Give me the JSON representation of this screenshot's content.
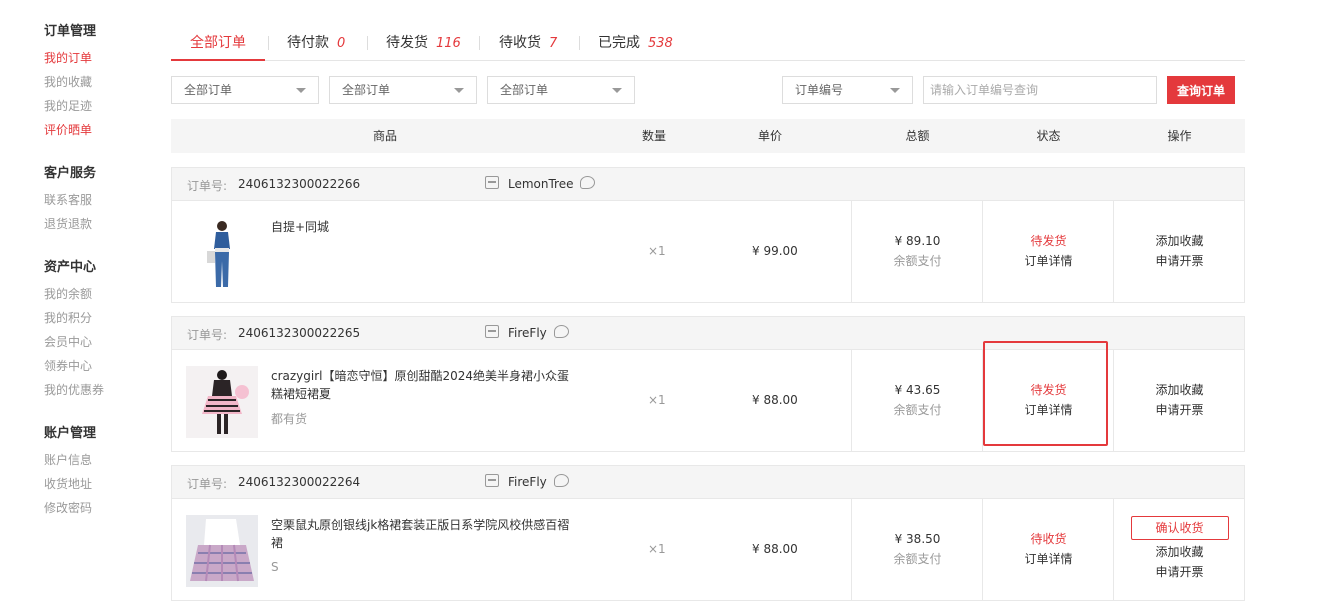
{
  "sidebar": [
    {
      "title": "订单管理",
      "items": [
        {
          "label": "我的订单",
          "active": true
        },
        {
          "label": "我的收藏",
          "active": false
        },
        {
          "label": "我的足迹",
          "active": false
        },
        {
          "label": "评价晒单",
          "active": true
        }
      ]
    },
    {
      "title": "客户服务",
      "items": [
        {
          "label": "联系客服"
        },
        {
          "label": "退货退款"
        }
      ]
    },
    {
      "title": "资产中心",
      "items": [
        {
          "label": "我的余额"
        },
        {
          "label": "我的积分"
        },
        {
          "label": "会员中心"
        },
        {
          "label": "领券中心"
        },
        {
          "label": "我的优惠券"
        }
      ]
    },
    {
      "title": "账户管理",
      "items": [
        {
          "label": "账户信息"
        },
        {
          "label": "收货地址"
        },
        {
          "label": "修改密码"
        }
      ]
    }
  ],
  "tabs": [
    {
      "label": "全部订单",
      "count": ""
    },
    {
      "label": "待付款",
      "count": "0"
    },
    {
      "label": "待发货",
      "count": "116"
    },
    {
      "label": "待收货",
      "count": "7"
    },
    {
      "label": "已完成",
      "count": "538"
    }
  ],
  "filters": {
    "select1": "全部订单",
    "select2": "全部订单",
    "select3": "全部订单",
    "search_type": "订单编号",
    "search_placeholder": "请输入订单编号查询",
    "search_button": "查询订单"
  },
  "table_headers": [
    "商品",
    "数量",
    "单价",
    "总额",
    "状态",
    "操作"
  ],
  "orders": [
    {
      "order_label": "订单号:",
      "order_no": "2406132300022266",
      "shop": "LemonTree",
      "title": "自提+同城",
      "spec": "",
      "qty": "×1",
      "unit_price": "¥ 99.00",
      "total": "¥ 89.10",
      "pay_method": "余额支付",
      "status": "待发货",
      "detail": "订单详情",
      "confirm": "",
      "actions": [
        "添加收藏",
        "申请开票"
      ]
    },
    {
      "order_label": "订单号:",
      "order_no": "2406132300022265",
      "shop": "FireFly",
      "title": "crazygirl【暗恋守恒】原创甜酷2024绝美半身裙小众蛋糕裙短裙夏",
      "spec": "都有货",
      "qty": "×1",
      "unit_price": "¥ 88.00",
      "total": "¥ 43.65",
      "pay_method": "余额支付",
      "status": "待发货",
      "detail": "订单详情",
      "confirm": "",
      "actions": [
        "添加收藏",
        "申请开票"
      ]
    },
    {
      "order_label": "订单号:",
      "order_no": "2406132300022264",
      "shop": "FireFly",
      "title": "空栗鼠丸原创银线jk格裙套装正版日系学院风校供感百褶裙",
      "spec": "S",
      "qty": "×1",
      "unit_price": "¥ 88.00",
      "total": "¥ 38.50",
      "pay_method": "余额支付",
      "status": "待收货",
      "detail": "订单详情",
      "confirm": "确认收货",
      "actions": [
        "添加收藏",
        "申请开票"
      ]
    }
  ]
}
